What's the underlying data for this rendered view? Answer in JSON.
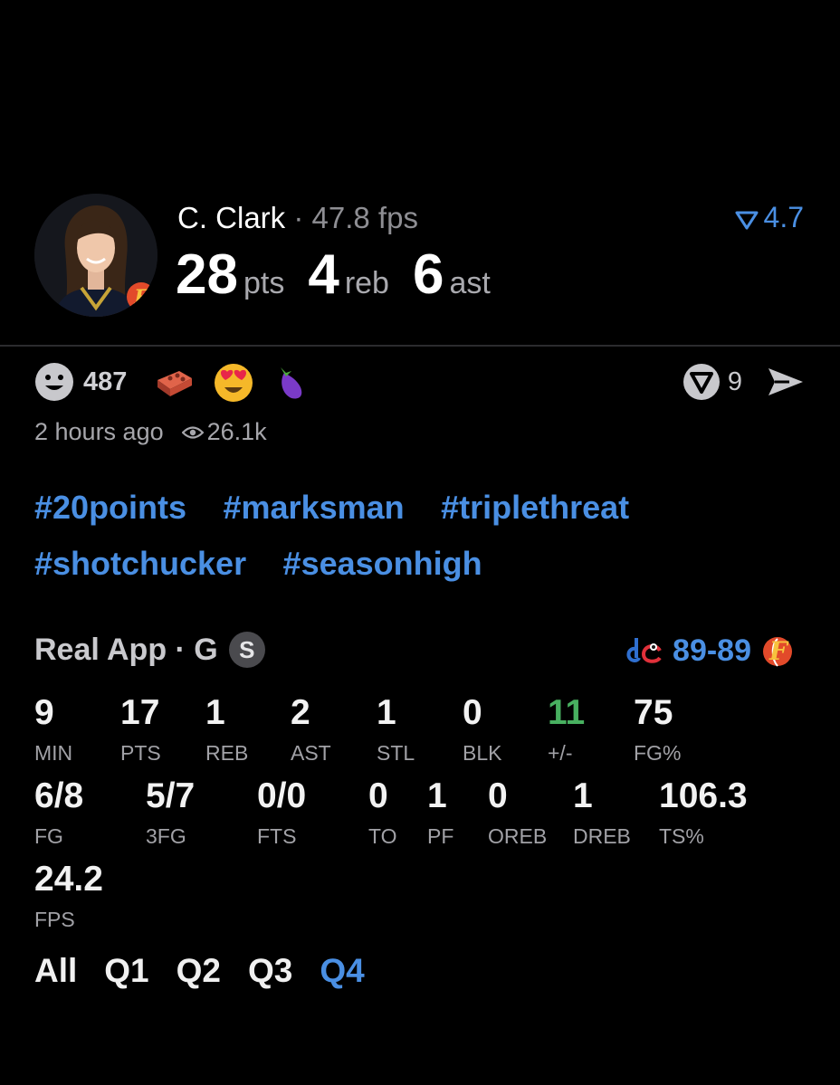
{
  "player": {
    "name": "C. Clark",
    "separator": "·",
    "fps_text": "47.8 fps",
    "pts": "28",
    "pts_label": "pts",
    "reb": "4",
    "reb_label": "reb",
    "ast": "6",
    "ast_label": "ast",
    "rating": "4.7",
    "avatar_icon": "player-headshot",
    "team_logo_icon": "fever-logo"
  },
  "reactions": {
    "count": "487",
    "icons": [
      "smiley-icon",
      "brick-emoji",
      "heart-eyes-emoji",
      "eggplant-emoji"
    ],
    "comments": "9",
    "share_icon": "send-icon"
  },
  "meta": {
    "time": "2 hours ago",
    "views": "26.1k"
  },
  "tags": [
    "#20points",
    "#marksman",
    "#triplethreat",
    "#shotchucker",
    "#seasonhigh"
  ],
  "game": {
    "source": "Real App · G",
    "badge": "S",
    "score": "89-89",
    "home_logo": "mystics-logo",
    "away_logo": "fever-logo"
  },
  "stats": {
    "row1": [
      {
        "v": "9",
        "l": "MIN"
      },
      {
        "v": "17",
        "l": "PTS"
      },
      {
        "v": "1",
        "l": "REB"
      },
      {
        "v": "2",
        "l": "AST"
      },
      {
        "v": "1",
        "l": "STL"
      },
      {
        "v": "0",
        "l": "BLK"
      },
      {
        "v": "11",
        "l": "+/-"
      },
      {
        "v": "75",
        "l": "FG%"
      }
    ],
    "row2": [
      {
        "v": "6/8",
        "l": "FG"
      },
      {
        "v": "5/7",
        "l": "3FG"
      },
      {
        "v": "0/0",
        "l": "FTS"
      },
      {
        "v": "0",
        "l": "TO"
      },
      {
        "v": "1",
        "l": "PF"
      },
      {
        "v": "0",
        "l": "OREB"
      },
      {
        "v": "1",
        "l": "DREB"
      },
      {
        "v": "106.3",
        "l": "TS%"
      }
    ],
    "row3": [
      {
        "v": "24.2",
        "l": "FPS"
      }
    ]
  },
  "quarters": [
    "All",
    "Q1",
    "Q2",
    "Q3",
    "Q4"
  ],
  "active_quarter": "Q4",
  "colors": {
    "accent": "#4a8fe3",
    "positive": "#48b060",
    "background": "#000000"
  }
}
